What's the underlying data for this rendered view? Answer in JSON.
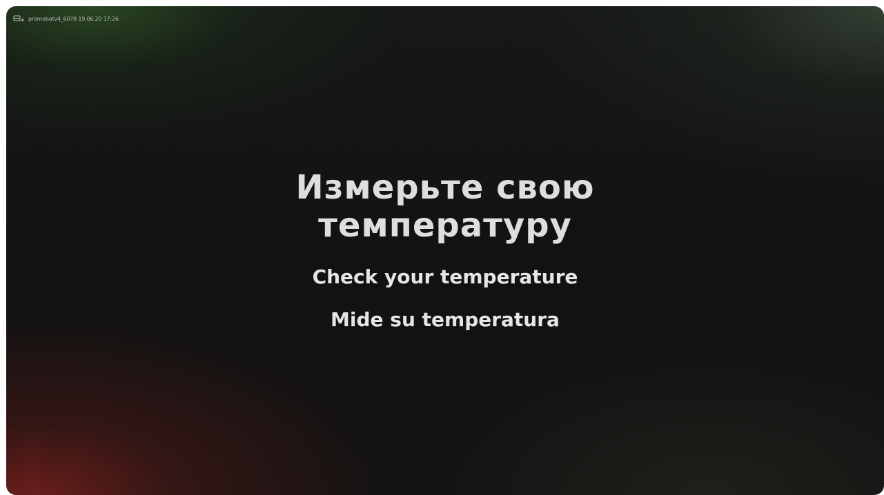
{
  "device": {
    "icon": "device-monitor-icon",
    "label": "promobotv4_6078 19.06.20  17:26"
  },
  "screen": {
    "title": "Измерьте свою температуру",
    "subtitle_en": "Check your temperature",
    "subtitle_es": "Mide su temperatura"
  },
  "colors": {
    "background": "#111111",
    "text": "#e6e6e6",
    "accent_red": "#78201c",
    "accent_green": "#2c4e24"
  }
}
